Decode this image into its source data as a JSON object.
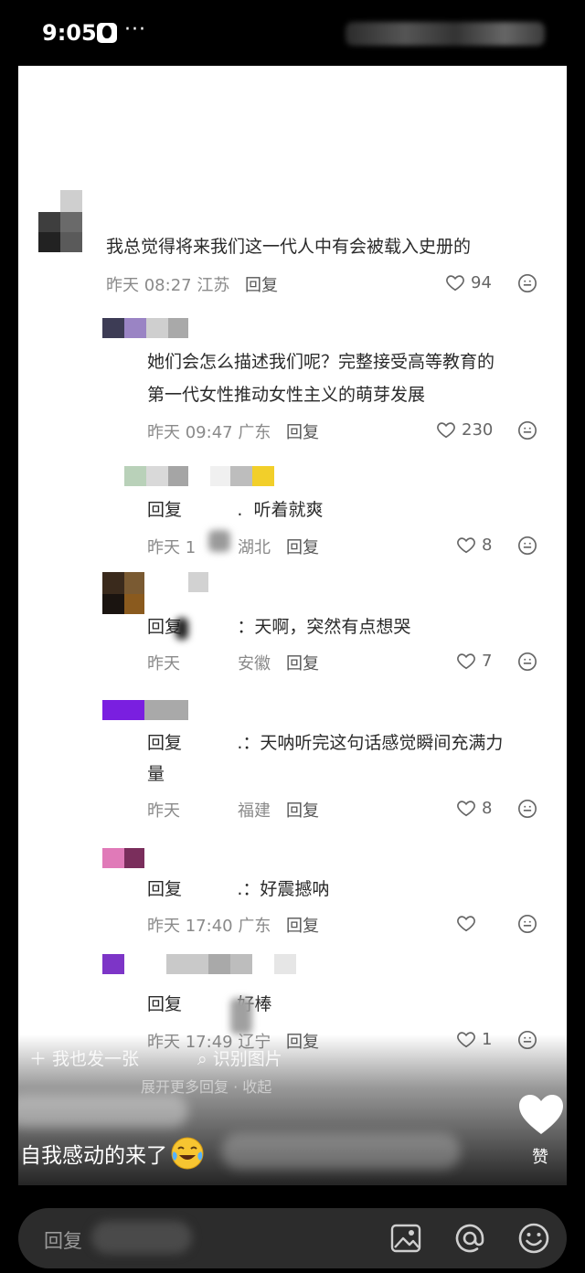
{
  "status_bar": {
    "time": "9:05",
    "more": "···"
  },
  "comments": [
    {
      "text_lines": [
        "我总觉得将来我们这一代人中有会被载入史册的"
      ],
      "time": "昨天 08:27 江苏",
      "reply": "回复",
      "likes": "94"
    },
    {
      "text_lines": [
        "她们会怎么描述我们呢？完整接受高等教育的",
        "第一代女性推动女性主义的萌芽发展"
      ],
      "time": "昨天 09:47 广东",
      "reply": "回复",
      "likes": "230"
    },
    {
      "text_lines": [
        "回复          .  听着就爽"
      ],
      "time": "昨天 1",
      "location": "湖北",
      "reply": "回复",
      "likes": "8"
    },
    {
      "text_lines": [
        "回复          ：天啊，突然有点想哭"
      ],
      "time": "昨天",
      "location": "安徽",
      "reply": "回复",
      "likes": "7"
    },
    {
      "text_lines": [
        "回复          .：天呐听完这句话感觉瞬间充满力",
        "量"
      ],
      "time": "昨天",
      "location": "福建",
      "reply": "回复",
      "likes": "8"
    },
    {
      "text_lines": [
        "回复          .：好震撼呐"
      ],
      "time": "昨天 17:40 广东",
      "reply": "回复",
      "likes": ""
    },
    {
      "text_lines": [
        "回复          好棒"
      ],
      "time": "昨天 17:49 辽宁",
      "reply": "回复",
      "likes": "1"
    }
  ],
  "overlay": {
    "same_post": "我也发一张",
    "identify_image": "识别图片",
    "collapse_text": "展开更多回复 · 收起",
    "caption": "自我感动的来了",
    "like_label": "赞"
  },
  "input_bar": {
    "placeholder": "回复"
  },
  "colors": {
    "background": "#000000",
    "panel": "#ffffff",
    "input_bar": "#2c2c2c"
  }
}
